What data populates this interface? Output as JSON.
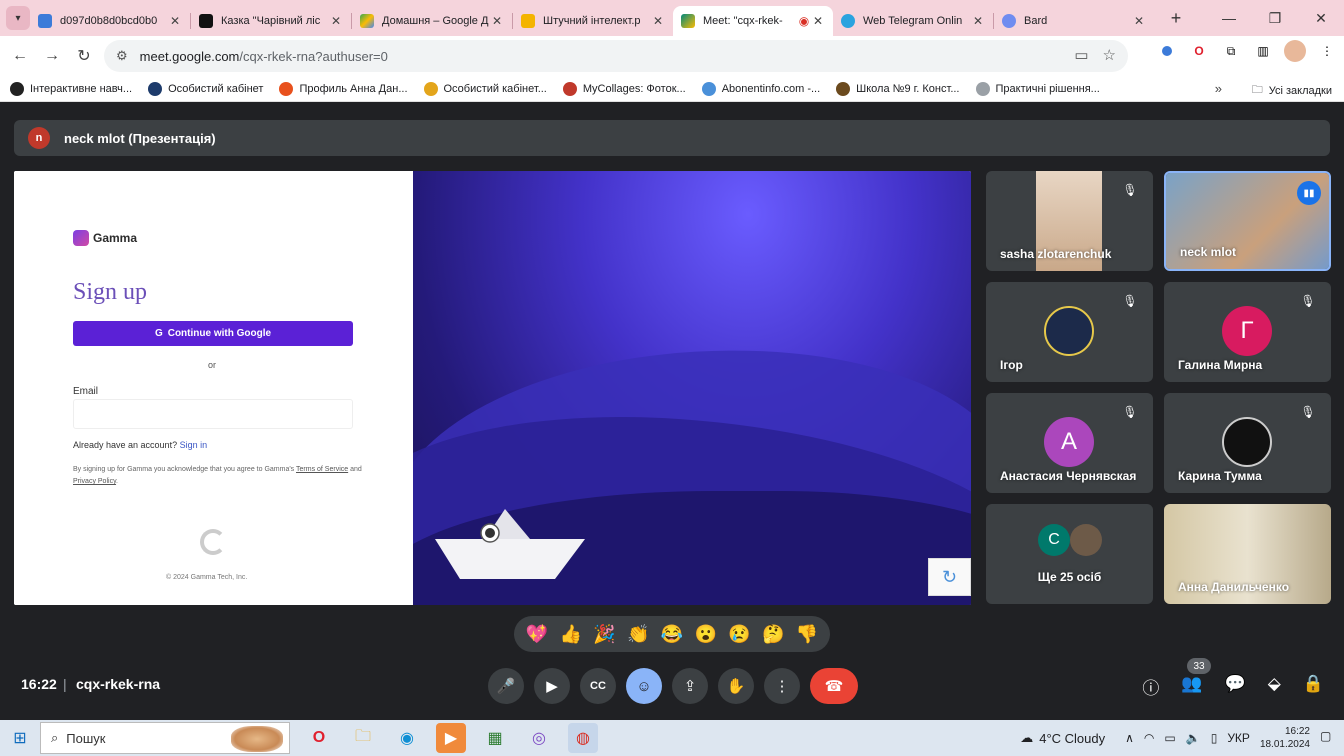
{
  "browser": {
    "tabs": [
      {
        "label": "d097d0b8d0bcd0b0",
        "icon_color": "#3c7bd9",
        "icon": "search-icon",
        "active": false
      },
      {
        "label": "Казка \"Чарівний ліс",
        "icon_color": "#111111",
        "icon": "image-icon",
        "active": false
      },
      {
        "label": "Домашня – Google Д",
        "icon_color": "#34a853",
        "icon": "drive-icon",
        "active": false
      },
      {
        "label": "Штучний інтелект.р",
        "icon_color": "#f4b400",
        "icon": "slides-icon",
        "active": false
      },
      {
        "label": "Meet: \"cqx-rkek-",
        "icon_color": "#00897b",
        "icon": "meet-icon",
        "active": true
      },
      {
        "label": "Web Telegram Onlin",
        "icon_color": "#2aa3df",
        "icon": "telegram-icon",
        "active": false
      },
      {
        "label": "Bard",
        "icon_color": "#6f8cf0",
        "icon": "bard-icon",
        "active": false
      }
    ],
    "url_host": "meet.google.com",
    "url_path": "/cqx-rkek-rna?authuser=0",
    "bookmarks": [
      {
        "label": "Інтерактивне навч...",
        "color": "#222222"
      },
      {
        "label": "Особистий кабінет",
        "color": "#1d3b6b"
      },
      {
        "label": "Профиль Анна Дан...",
        "color": "#e8511d"
      },
      {
        "label": "Особистий кабінет...",
        "color": "#e3a51b"
      },
      {
        "label": "MyCollages: Фоток...",
        "color": "#c0392b"
      },
      {
        "label": "Abonentinfo.com -...",
        "color": "#4a90d9"
      },
      {
        "label": "Школа №9 г. Конст...",
        "color": "#6b4a1e"
      },
      {
        "label": "Практичні рішення...",
        "color": "#9aa0a6"
      }
    ],
    "all_bookmarks": "Усі закладки"
  },
  "meet": {
    "presenter_initial": "n",
    "presenter_title": "neck mlot (Презентація)",
    "slide": {
      "brand": "Gamma",
      "title": "Sign up",
      "google_btn": "Continue with Google",
      "or": "or",
      "email_label": "Email",
      "already": "Already have an account?",
      "sign_in": "Sign in",
      "terms_pre": "By signing up for Gamma you acknowledge that you agree to Gamma's",
      "terms_link": "Terms of Service",
      "terms_and": "and",
      "privacy_link": "Privacy Policy",
      "copyright": "© 2024 Gamma Tech, Inc."
    },
    "participants": [
      {
        "name": "sasha zlotarenchuk",
        "muted": true
      },
      {
        "name": "neck mlot",
        "muted": false,
        "speaking": true
      },
      {
        "name": "Ігор",
        "muted": true
      },
      {
        "name": "Галина Мирна",
        "muted": true,
        "initial": "Г",
        "color": "#d81b60"
      },
      {
        "name": "Анастасия Чернявская",
        "muted": true,
        "initial": "А",
        "color": "#ab47bc"
      },
      {
        "name": "Карина Тумма",
        "muted": true
      },
      {
        "name": "Ще 25 осіб",
        "initial": "C",
        "color": "#00796b"
      },
      {
        "name": "Анна Данильченко"
      }
    ],
    "reactions": [
      "💖",
      "👍",
      "🎉",
      "👏",
      "😂",
      "😮",
      "😢",
      "🤔",
      "👎"
    ],
    "time": "16:22",
    "sep": "|",
    "code": "cqx-rkek-rna",
    "participant_count": "33"
  },
  "taskbar": {
    "search_placeholder": "Пошук",
    "weather": "4°C  Cloudy",
    "lang": "УКР",
    "clock_time": "16:22",
    "clock_date": "18.01.2024"
  }
}
